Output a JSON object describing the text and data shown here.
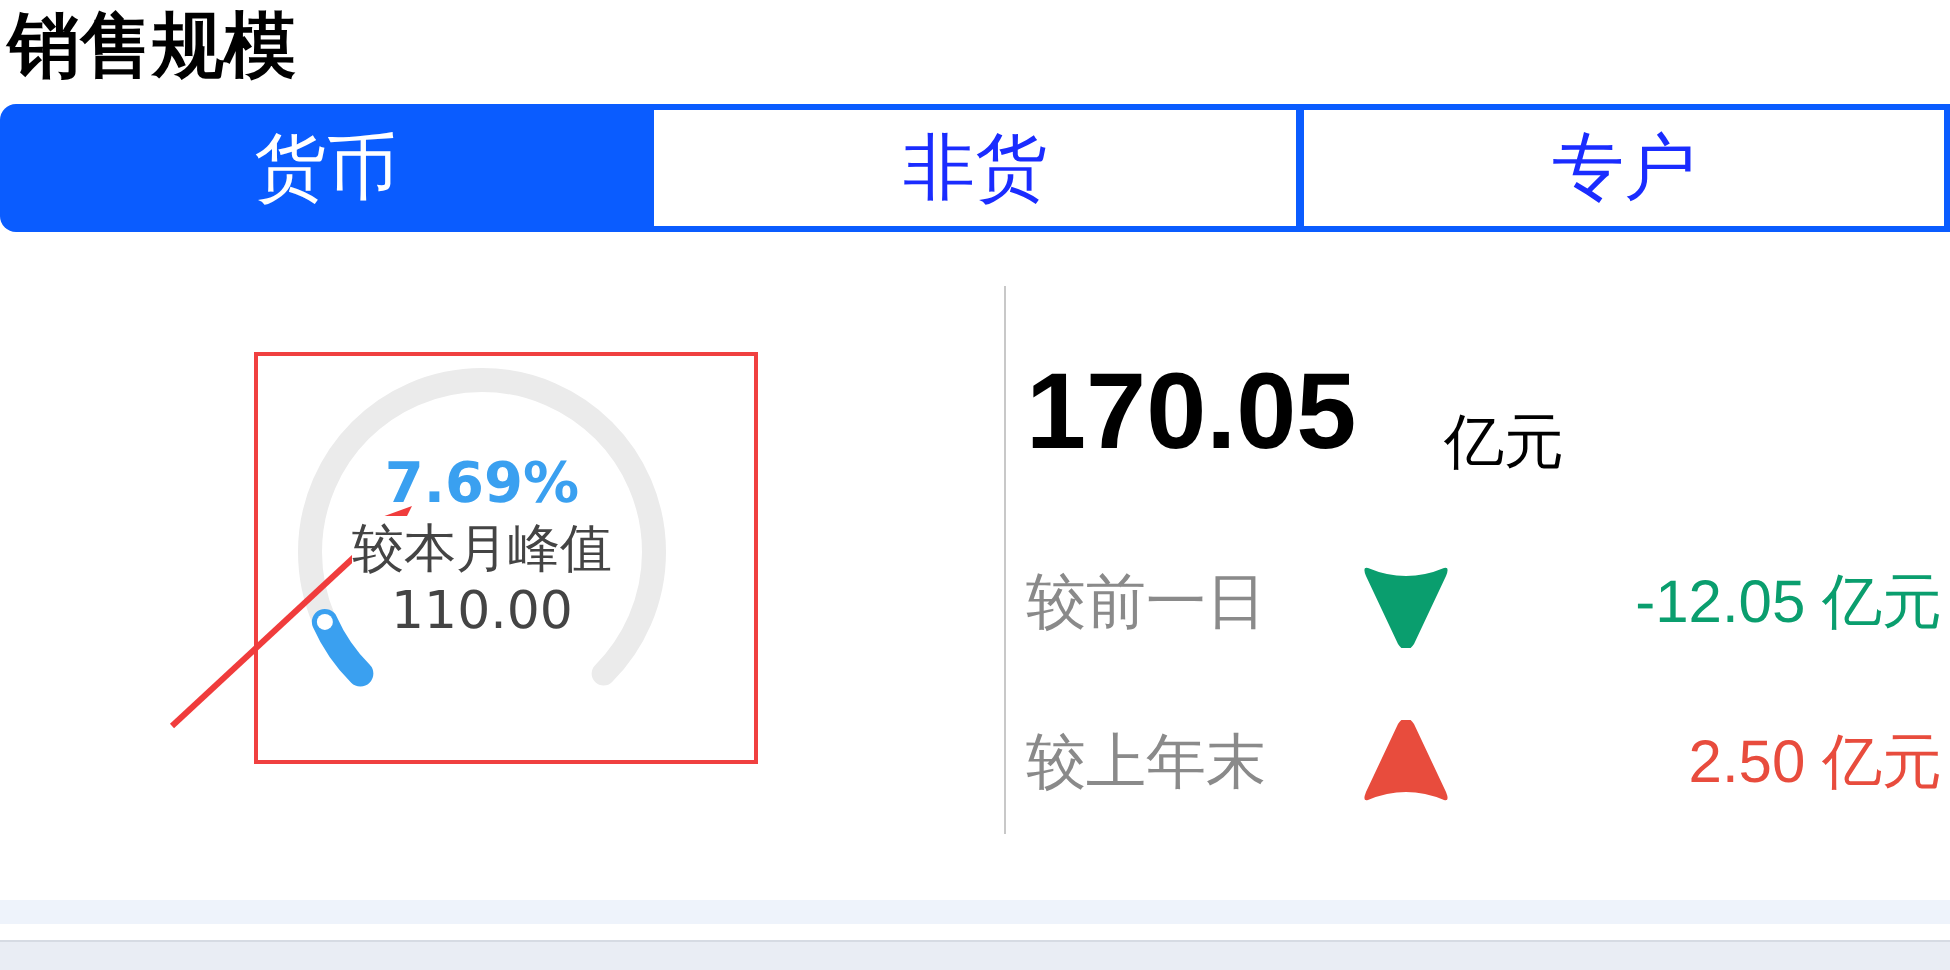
{
  "title": "销售规模",
  "tabs": [
    {
      "label": "货币",
      "selected": true
    },
    {
      "label": "非货",
      "selected": false
    },
    {
      "label": "专户",
      "selected": false
    }
  ],
  "gauge": {
    "percent": "7.69%",
    "label": "较本月峰值",
    "value": "110.00"
  },
  "total": {
    "value": "170.05",
    "unit": "亿元"
  },
  "comparisons": [
    {
      "label": "较前一日",
      "kind": "down",
      "value": "-12.05 亿元",
      "color": "#0a9e6e"
    },
    {
      "label": "较上年末",
      "kind": "up",
      "value": "2.50 亿元",
      "color": "#e84c3d"
    }
  ]
}
